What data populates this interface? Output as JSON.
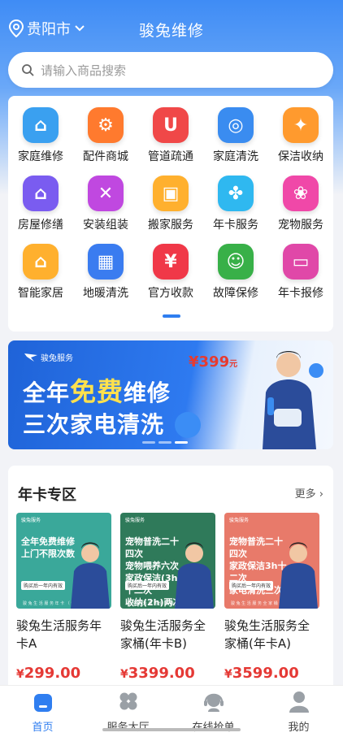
{
  "header": {
    "location": "贵阳市",
    "title": "骏兔维修",
    "search_placeholder": "请输入商品搜索"
  },
  "services": [
    {
      "label": "家庭维修",
      "icon": "home-repair-icon",
      "color": "#3aa0f0",
      "glyph": "⌂"
    },
    {
      "label": "配件商城",
      "icon": "parts-gear-icon",
      "color": "#ff7a2e",
      "glyph": "⚙"
    },
    {
      "label": "管道疏通",
      "icon": "pipe-icon",
      "color": "#f04848",
      "glyph": "U"
    },
    {
      "label": "家庭清洗",
      "icon": "washer-icon",
      "color": "#3a8cf0",
      "glyph": "◎"
    },
    {
      "label": "保洁收纳",
      "icon": "broom-icon",
      "color": "#ff9a2e",
      "glyph": "✦"
    },
    {
      "label": "房屋修缮",
      "icon": "house-fix-icon",
      "color": "#7a5cf0",
      "glyph": "⌂"
    },
    {
      "label": "安装组装",
      "icon": "tools-icon",
      "color": "#c048e0",
      "glyph": "✕"
    },
    {
      "label": "搬家服务",
      "icon": "truck-icon",
      "color": "#ffb02e",
      "glyph": "▣"
    },
    {
      "label": "年卡服务",
      "icon": "card-service-icon",
      "color": "#2fb8f0",
      "glyph": "✤"
    },
    {
      "label": "宠物服务",
      "icon": "paw-icon",
      "color": "#f048a8",
      "glyph": "❀"
    },
    {
      "label": "智能家居",
      "icon": "smart-home-icon",
      "color": "#ffb02e",
      "glyph": "⌂"
    },
    {
      "label": "地暖清洗",
      "icon": "floor-heat-icon",
      "color": "#3a7cf0",
      "glyph": "▦"
    },
    {
      "label": "官方收款",
      "icon": "yen-icon",
      "color": "#f03848",
      "glyph": "¥"
    },
    {
      "label": "故障保修",
      "icon": "user-shield-icon",
      "color": "#38b048",
      "glyph": "☺"
    },
    {
      "label": "年卡报修",
      "icon": "card-repair-icon",
      "color": "#e048a8",
      "glyph": "▭"
    }
  ],
  "banner": {
    "brand": "骏兔服务",
    "line1_a": "全年",
    "line1_em": "免费",
    "line1_b": "维修",
    "line2": "三次家电清洗",
    "price": "¥399",
    "price_unit": "元"
  },
  "annual": {
    "title": "年卡专区",
    "more": "更多",
    "cards": [
      {
        "name": "骏兔生活服务年卡A",
        "price_symbol": "¥",
        "price": "299.00",
        "bg": "#3aa89a",
        "thumb_lines": [
          "全年免费维修",
          "上门不限次数"
        ],
        "chip": "购买后一年内有效",
        "foot": "骏 兔 生 活 服 务 年 卡 （ 维 修 类 ）"
      },
      {
        "name": "骏兔生活服务全家桶(年卡B)",
        "price_symbol": "¥",
        "price": "3399.00",
        "bg": "#2f7a5a",
        "thumb_lines": [
          "宠物普洗二十四次",
          "宠物喂养六次",
          "家政保洁(3h)十二次",
          "收纳(2h)两次"
        ],
        "chip": "购买后一年内有效",
        "foot": "骏 兔 生 活 服 务 全 家 桶 年 卡 B"
      },
      {
        "name": "骏兔生活服务全家桶(年卡A)",
        "price_symbol": "¥",
        "price": "3599.00",
        "bg": "#e87a6a",
        "thumb_lines": [
          "宠物普洗二十四次",
          "家政保洁3h十二次",
          "家电清洗三次"
        ],
        "chip": "购买后一年内有效",
        "foot": "骏 兔 生 活 服 务 全 家 桶 年 卡 A"
      }
    ]
  },
  "tabs": [
    {
      "label": "首页",
      "icon": "home-tab-icon",
      "active": true
    },
    {
      "label": "服务大厅",
      "icon": "service-hall-icon",
      "active": false
    },
    {
      "label": "在线抢单",
      "icon": "headset-icon",
      "active": false
    },
    {
      "label": "我的",
      "icon": "profile-icon",
      "active": false
    }
  ],
  "colors": {
    "accent": "#2f7ef0",
    "price": "#e53935"
  }
}
